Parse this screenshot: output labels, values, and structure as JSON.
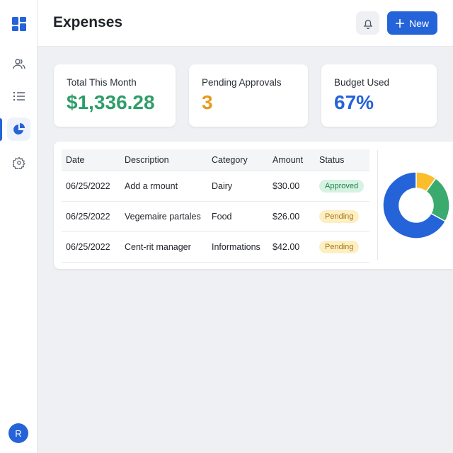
{
  "header": {
    "title": "Expenses",
    "new_label": "New"
  },
  "sidebar": {
    "items": [
      {
        "icon": "dashboard-icon"
      },
      {
        "icon": "users-icon"
      },
      {
        "icon": "list-icon"
      },
      {
        "icon": "pie-chart-icon",
        "active": true
      },
      {
        "icon": "gear-icon"
      }
    ],
    "avatar": "R"
  },
  "cards": [
    {
      "label": "Total This Month",
      "value": "$1,336.28",
      "color": "#2e9e6a"
    },
    {
      "label": "Pending Approvals",
      "value": "3",
      "color": "#e89a1c"
    },
    {
      "label": "Budget Used",
      "value": "67%",
      "color": "#2563d8"
    }
  ],
  "table": {
    "headers": [
      "Date",
      "Description",
      "Category",
      "Amount",
      "Status"
    ],
    "rows": [
      [
        "06/25/2022",
        "Add a rmount",
        "Dairy",
        "$30.00",
        "Approved"
      ],
      [
        "06/25/2022",
        "Vegemaire partales",
        "Food",
        "$26.00",
        "Pending"
      ],
      [
        "06/25/2022",
        "Cent-rit manager",
        "Informations",
        "$42.00",
        "Pending"
      ]
    ]
  },
  "chart_data": {
    "type": "pie",
    "donut": true,
    "values": [
      67,
      23,
      10
    ],
    "colors": [
      "#2563d8",
      "#3aaa6e",
      "#fbbd2c"
    ]
  }
}
